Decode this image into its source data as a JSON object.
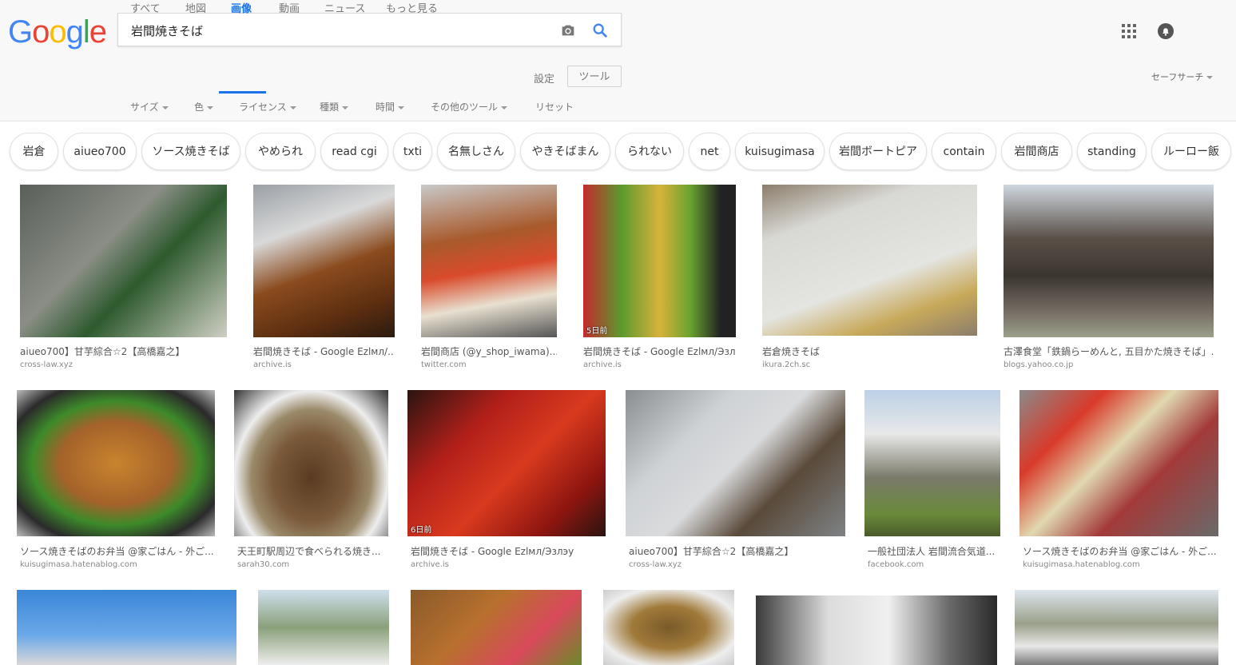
{
  "search": {
    "logo": "Google",
    "query": "岩間焼きそば"
  },
  "header_icons": {
    "camera": "camera-icon",
    "search": "search-icon",
    "apps": "apps-grid-icon",
    "notifications": "notifications-icon"
  },
  "tabs": [
    "すべて",
    "地図",
    "画像",
    "動画",
    "ニュース",
    "もっと見る"
  ],
  "active_tab": "画像",
  "settings_label": "設定",
  "tools_label": "ツール",
  "safesearch_label": "セーフサーチ",
  "filters": [
    "サイズ",
    "色",
    "ライセンス",
    "種類",
    "時間",
    "その他のツール",
    "リセット"
  ],
  "chips": [
    "岩倉",
    "aiueo700",
    "ソース焼きそば",
    "やめられ",
    "read cgi",
    "txti",
    "名無しさん",
    "やきそばまん",
    "られない",
    "net",
    "kuisugimasa",
    "岩間ボートピア",
    "contain",
    "岩間商店",
    "standing",
    "ルーロー飯"
  ],
  "results": [
    {
      "title": "aiueo700】甘芋綜合☆2【高橋嘉之】",
      "site": "cross-law.xyz",
      "age": ""
    },
    {
      "title": "岩間焼きそば - Google Ezlмл/...",
      "site": "archive.is",
      "age": ""
    },
    {
      "title": "岩間商店 (@y_shop_iwama)...",
      "site": "twitter.com",
      "age": ""
    },
    {
      "title": "岩間焼きそば - Google Ezlмл/Эзл...",
      "site": "archive.is",
      "age": "5日前"
    },
    {
      "title": "岩倉焼きそば",
      "site": "ikura.2ch.sc",
      "age": ""
    },
    {
      "title": "古澤食堂「鉄鍋らーめんと, 五目かた焼きそば」...",
      "site": "blogs.yahoo.co.jp",
      "age": ""
    },
    {
      "title": "ソース焼きそばのお弁当 @家ごはん - 外ご...",
      "site": "kuisugimasa.hatenablog.com",
      "age": ""
    },
    {
      "title": "天王町駅周辺で食べられる焼き...",
      "site": "sarah30.com",
      "age": ""
    },
    {
      "title": "岩間焼きそば - Google Ezlмл/Эзлэу",
      "site": "archive.is",
      "age": "6日前"
    },
    {
      "title": "aiueo700】甘芋綜合☆2【高橋嘉之】",
      "site": "cross-law.xyz",
      "age": ""
    },
    {
      "title": "一般社団法人 岩間流合気道...",
      "site": "facebook.com",
      "age": ""
    },
    {
      "title": "ソース焼きそばのお弁当 @家ごはん - 外ご...",
      "site": "kuisugimasa.hatenablog.com",
      "age": ""
    },
    {
      "title": "",
      "site": "",
      "age": ""
    },
    {
      "title": "",
      "site": "",
      "age": ""
    },
    {
      "title": "",
      "site": "",
      "age": ""
    },
    {
      "title": "",
      "site": "",
      "age": ""
    },
    {
      "title": "",
      "site": "",
      "age": ""
    },
    {
      "title": "",
      "site": "",
      "age": ""
    }
  ],
  "colors": {
    "accent": "#1a73e8",
    "logo": [
      "#4285f4",
      "#ea4335",
      "#fbbc05",
      "#4285f4",
      "#34a853",
      "#ea4335"
    ]
  }
}
